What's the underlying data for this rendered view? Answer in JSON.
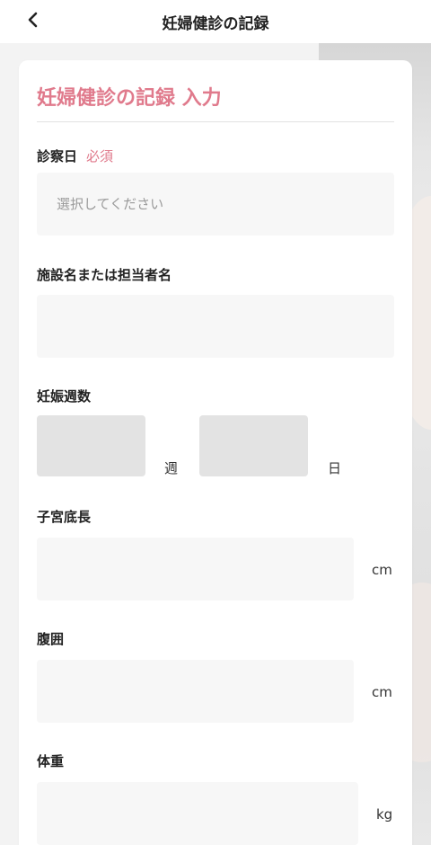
{
  "header": {
    "title": "妊婦健診の記録",
    "back_icon": "chevron-left-icon"
  },
  "form": {
    "title": "妊婦健診の記録 入力",
    "exam_date": {
      "label": "診察日",
      "required_label": "必須",
      "placeholder": "選択してください"
    },
    "facility": {
      "label": "施設名または担当者名",
      "value": ""
    },
    "gestational_age": {
      "label": "妊娠週数",
      "weeks_unit": "週",
      "days_unit": "日"
    },
    "fundal_height": {
      "label": "子宮底長",
      "unit": "cm"
    },
    "abdominal_circumference": {
      "label": "腹囲",
      "unit": "cm"
    },
    "weight": {
      "label": "体重",
      "unit": "kg"
    }
  },
  "colors": {
    "accent": "#e07a8c",
    "field_bg": "#f7f7f7",
    "field_gray": "#e3e3e3"
  }
}
